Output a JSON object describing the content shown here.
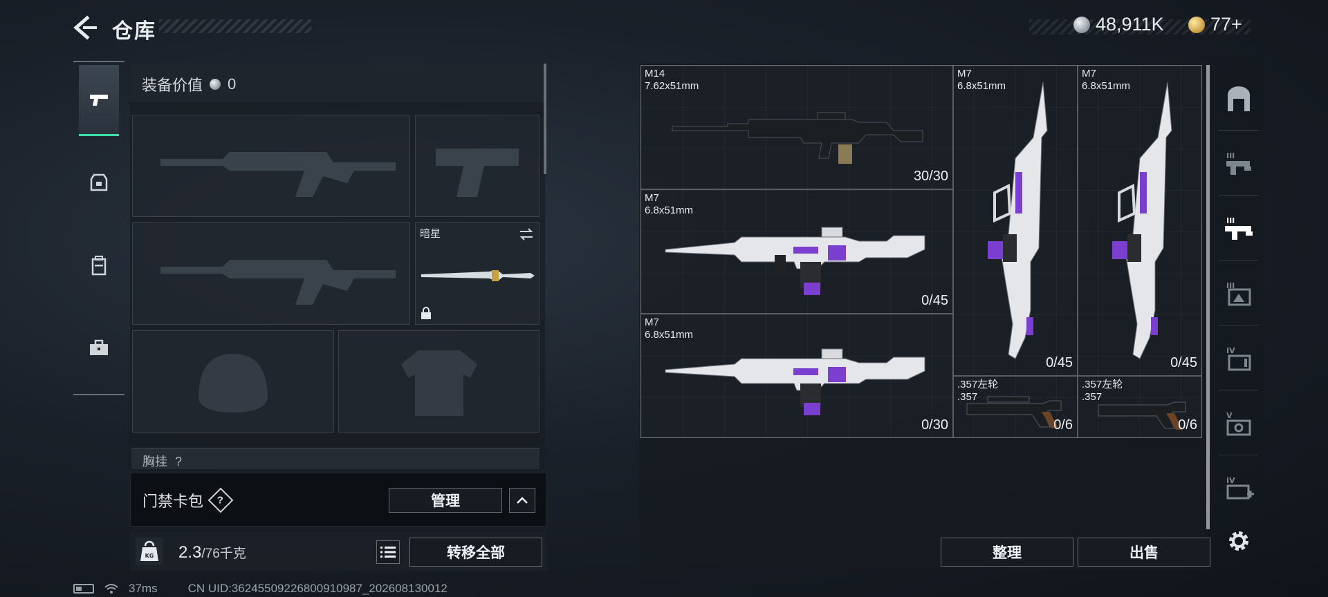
{
  "header": {
    "title": "仓库",
    "silver_amount": "48,911K",
    "gold_amount": "77+"
  },
  "equipment": {
    "value_label": "装备价值",
    "value": "0",
    "secondary_slot_name": "暗星",
    "partial_section_label": "胸挂",
    "partial_section_badge": "?"
  },
  "card_bag": {
    "label": "门禁卡包",
    "help": "?",
    "manage_label": "管理"
  },
  "weight": {
    "current": "2.3",
    "max": "/76千克",
    "transfer_all_label": "转移全部",
    "kg_icon_text": "KG"
  },
  "status_bar": {
    "ping": "37ms",
    "uid": "CN UID:36245509226800910987_202608130012"
  },
  "inventory": {
    "items": [
      {
        "name": "M14",
        "caliber": "7.62x51mm",
        "ammo": "30/30"
      },
      {
        "name": "M7",
        "caliber": "6.8x51mm",
        "ammo": "0/45"
      },
      {
        "name": "M7",
        "caliber": "6.8x51mm",
        "ammo": "0/30"
      },
      {
        "name": "M7",
        "caliber": "6.8x51mm",
        "ammo": "0/45"
      },
      {
        "name": "M7",
        "caliber": "6.8x51mm",
        "ammo": "0/45"
      },
      {
        "name": ".357左轮",
        "caliber": ".357",
        "ammo": "0/6"
      },
      {
        "name": ".357左轮",
        "caliber": ".357",
        "ammo": "0/6"
      }
    ],
    "sort_label": "整理",
    "sell_label": "出售"
  },
  "rail": {
    "tier_labels": [
      "III",
      "III",
      "III",
      "IV",
      "V",
      "IV"
    ]
  },
  "colors": {
    "accent": "#3fe0a8",
    "purple": "#7b3fd0",
    "panel": "#181c22"
  }
}
